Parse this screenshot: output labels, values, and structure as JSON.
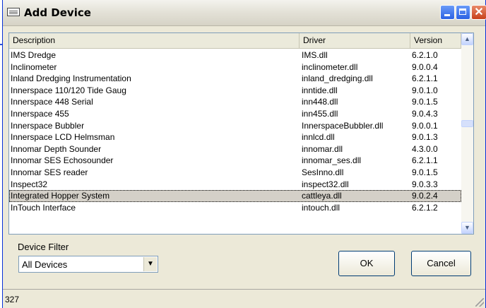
{
  "window": {
    "title": "Add Device"
  },
  "list": {
    "columns": [
      "Description",
      "Driver",
      "Version"
    ],
    "rows": [
      {
        "description": "IMS Dredge",
        "driver": "IMS.dll",
        "version": "6.2.1.0"
      },
      {
        "description": "Inclinometer",
        "driver": "inclinometer.dll",
        "version": "9.0.0.4"
      },
      {
        "description": "Inland Dredging Instrumentation",
        "driver": "inland_dredging.dll",
        "version": "6.2.1.1"
      },
      {
        "description": "Innerspace 110/120 Tide Gaug",
        "driver": "inntide.dll",
        "version": "9.0.1.0"
      },
      {
        "description": "Innerspace 448 Serial",
        "driver": "inn448.dll",
        "version": "9.0.1.5"
      },
      {
        "description": "Innerspace 455",
        "driver": "inn455.dll",
        "version": "9.0.4.3"
      },
      {
        "description": "Innerspace Bubbler",
        "driver": "InnerspaceBubbler.dll",
        "version": "9.0.0.1"
      },
      {
        "description": "Innerspace LCD Helmsman",
        "driver": "innlcd.dll",
        "version": "9.0.1.3"
      },
      {
        "description": "Innomar Depth Sounder",
        "driver": "innomar.dll",
        "version": "4.3.0.0"
      },
      {
        "description": "Innomar SES Echosounder",
        "driver": "innomar_ses.dll",
        "version": "6.2.1.1"
      },
      {
        "description": "Innomar SES reader",
        "driver": "SesInno.dll",
        "version": "9.0.1.5"
      },
      {
        "description": "Inspect32",
        "driver": "inspect32.dll",
        "version": "9.0.3.3"
      },
      {
        "description": "Integrated Hopper System",
        "driver": "cattleya.dll",
        "version": "9.0.2.4",
        "selected": true
      },
      {
        "description": "InTouch Interface",
        "driver": "intouch.dll",
        "version": "6.2.1.2"
      }
    ],
    "scroll_up_glyph": "▲",
    "scroll_down_glyph": "▼"
  },
  "filter": {
    "label": "Device Filter",
    "selected": "All Devices",
    "arrow_glyph": "▼"
  },
  "buttons": {
    "ok": "OK",
    "cancel": "Cancel"
  },
  "status": {
    "count": "327"
  },
  "icons": {
    "title": "keyboard-icon",
    "minimize": "minimize-icon",
    "maximize": "maximize-icon",
    "close": "close-icon",
    "close_glyph": "✕"
  },
  "colors": {
    "selection": "#d4d0c8",
    "accent": "#0831d9",
    "close": "#c8401a"
  }
}
